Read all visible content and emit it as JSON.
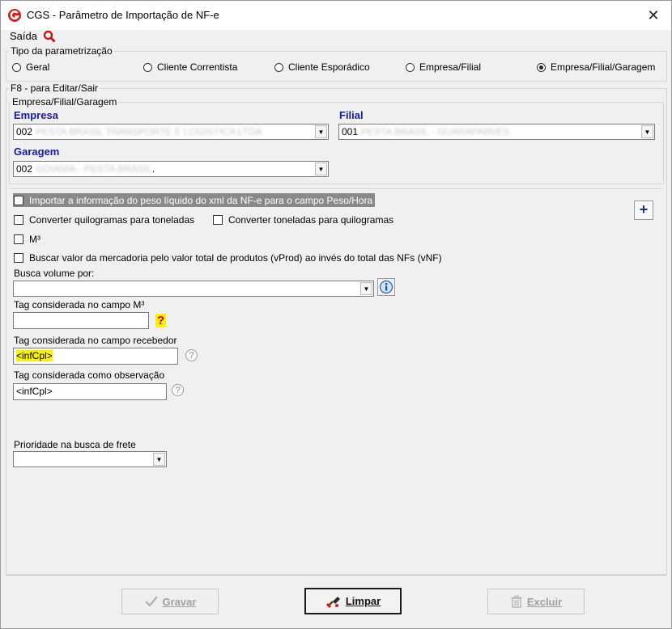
{
  "window": {
    "title": "CGS - Parâmetro de Importação de NF-e",
    "close": "✕"
  },
  "menu": {
    "saida_label": "Saída"
  },
  "tipo": {
    "legend": "Tipo da parametrização",
    "options": [
      {
        "label": "Geral",
        "selected": false
      },
      {
        "label": "Cliente Correntista",
        "selected": false
      },
      {
        "label": "Cliente Esporádico",
        "selected": false
      },
      {
        "label": "Empresa/Filial",
        "selected": false
      },
      {
        "label": "Empresa/Filial/Garagem",
        "selected": true
      }
    ]
  },
  "f8": {
    "legend": "F8 - para Editar/Sair"
  },
  "efg": {
    "legend": "Empresa/Filial/Garagem",
    "empresa_label": "Empresa",
    "empresa_code": "002",
    "empresa_name": "PESTA BRASIL TRANSPORTE E LOGISTICA LTDA",
    "filial_label": "Filial",
    "filial_code": "001",
    "filial_name": "PESTA BRASIL - GUARAPARI/ES",
    "garagem_label": "Garagem",
    "garagem_code": "002",
    "garagem_name": "GOIANIA - PESTA BRASIL",
    "garagem_suffix": "."
  },
  "checks": {
    "importar_peso": {
      "label": "Importar a informação do peso líquido do xml da NF-e para o campo Peso/Hora",
      "checked": false
    },
    "kg_ton": {
      "label": "Converter quilogramas para toneladas",
      "checked": false
    },
    "ton_kg": {
      "label": "Converter toneladas para quilogramas",
      "checked": false
    },
    "m3": {
      "label": "M³",
      "checked": false
    },
    "vprod": {
      "label": "Buscar valor da mercadoria pelo valor total de produtos (vProd) ao invés do total das NFs (vNF)",
      "checked": false
    }
  },
  "fields": {
    "busca_volume_label": "Busca volume por:",
    "busca_volume_value": "",
    "tag_m3_label": "Tag considerada no campo M³",
    "tag_m3_value": "",
    "tag_recebedor_label": "Tag considerada no campo recebedor",
    "tag_recebedor_value": "<infCpl>",
    "tag_obs_label": "Tag considerada como observação",
    "tag_obs_value": "<infCpl>",
    "prioridade_label": "Prioridade na busca de frete",
    "prioridade_value": ""
  },
  "glyphs": {
    "question": "?",
    "plus": "+",
    "dropdown": "▼"
  },
  "buttons": {
    "gravar": {
      "label": "Gravar",
      "enabled": false
    },
    "limpar": {
      "label": "Limpar",
      "enabled": true
    },
    "excluir": {
      "label": "Excluir",
      "enabled": false
    }
  },
  "colors": {
    "accent_blue": "#1a1aa0",
    "highlight_yellow": "#fff200",
    "app_red": "#d42020"
  }
}
